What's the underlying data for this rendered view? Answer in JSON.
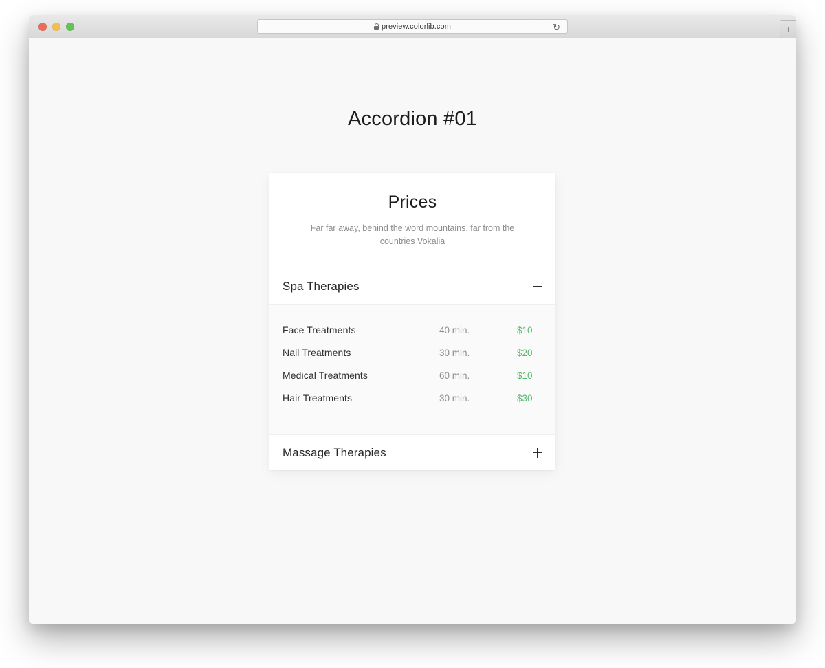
{
  "browser": {
    "url": "preview.colorlib.com",
    "lock_icon": "lock-icon",
    "reload_icon": "↻",
    "newtab_label": "+",
    "traffic_lights": [
      "close",
      "minimize",
      "zoom"
    ]
  },
  "page": {
    "title": "Accordion #01"
  },
  "card": {
    "title": "Prices",
    "subtitle": "Far far away, behind the word mountains, far from the countries Vokalia"
  },
  "accordion": {
    "panels": [
      {
        "title": "Spa Therapies",
        "expanded": true,
        "toggle_icon": "minus-icon",
        "rows": [
          {
            "name": "Face Treatments",
            "duration": "40 min.",
            "price": "$10"
          },
          {
            "name": "Nail Treatments",
            "duration": "30 min.",
            "price": "$20"
          },
          {
            "name": "Medical Treatments",
            "duration": "60 min.",
            "price": "$10"
          },
          {
            "name": "Hair Treatments",
            "duration": "30 min.",
            "price": "$30"
          }
        ]
      },
      {
        "title": "Massage Therapies",
        "expanded": false,
        "toggle_icon": "plus-icon",
        "rows": []
      }
    ]
  },
  "colors": {
    "price_green": "#57b86f",
    "page_background": "#f8f8f8",
    "card_background": "#ffffff",
    "panel_body_background": "#fafafa",
    "heading_text": "#1d1d1d",
    "muted_text": "#8b8b8b"
  }
}
